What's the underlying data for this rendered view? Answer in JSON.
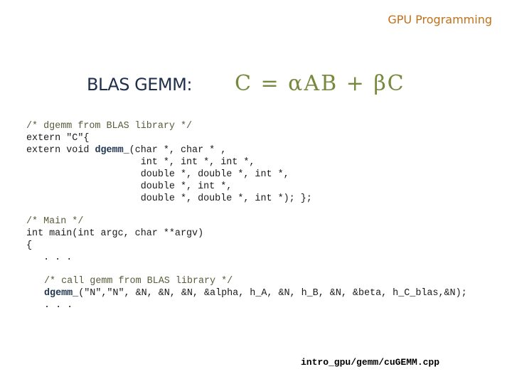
{
  "header": {
    "title": "GPU Programming"
  },
  "slide": {
    "heading": "BLAS GEMM:",
    "formula": "C = αAB + βC"
  },
  "code": {
    "block1": {
      "comment": "/* dgemm from BLAS library */",
      "line_extern_c": "extern \"C\"{",
      "line_decl_prefix": "extern void ",
      "line_decl_func": "dgemm_",
      "line_decl_suffix": "(char *, char * ,",
      "line_args_1": "                    int *, int *, int *,",
      "line_args_2": "                    double *, double *, int *,",
      "line_args_3": "                    double *, int *,",
      "line_args_4": "                    double *, double *, int *); };"
    },
    "block2": {
      "comment": "/* Main */",
      "line_main": "int main(int argc, char **argv)",
      "line_brace": "{",
      "line_ellipsis": "   . . ."
    },
    "block3": {
      "comment": "/* call gemm from BLAS library */",
      "line_call_func": "dgemm_",
      "line_call_args": "(\"N\",\"N\", &N, &N, &N, &alpha, h_A, &N, h_B, &N, &beta, h_C_blas,&N);",
      "line_ellipsis": ". . ."
    }
  },
  "footer": {
    "file_path": "intro_gpu/gemm/cuGEMM.cpp"
  }
}
